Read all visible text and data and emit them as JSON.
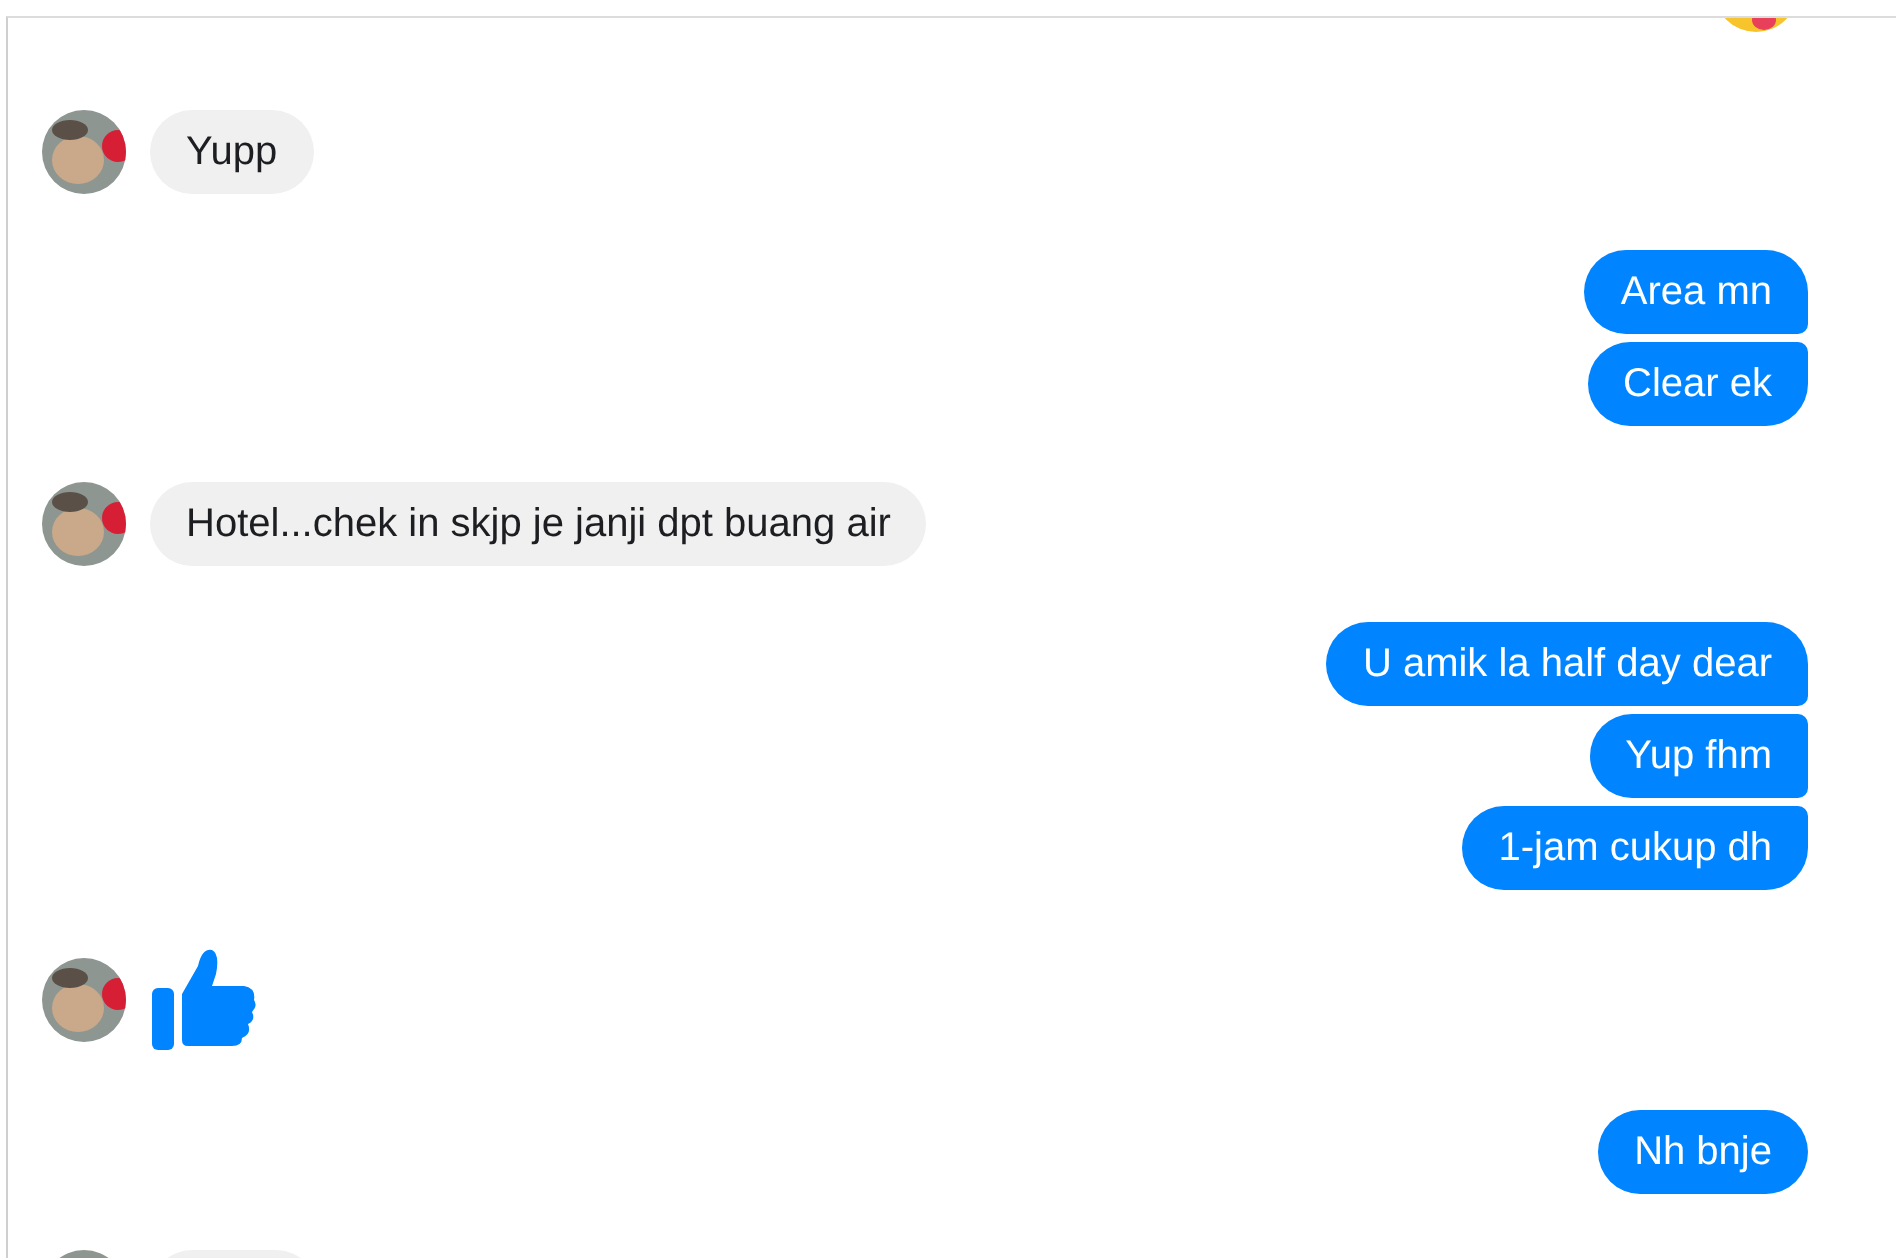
{
  "chat": {
    "groups": [
      {
        "kind": "outgoing",
        "messages": [
          {
            "kind": "emoji"
          }
        ]
      },
      {
        "kind": "incoming",
        "messages": [
          {
            "kind": "text",
            "text": "Yupp"
          }
        ]
      },
      {
        "kind": "outgoing",
        "messages": [
          {
            "kind": "text",
            "text": "Area mn"
          },
          {
            "kind": "text",
            "text": "Clear ek"
          }
        ]
      },
      {
        "kind": "incoming",
        "messages": [
          {
            "kind": "text",
            "text": "Hotel...chek in skjp je janji dpt buang air"
          }
        ]
      },
      {
        "kind": "outgoing",
        "messages": [
          {
            "kind": "text",
            "text": "U amik la half day dear"
          },
          {
            "kind": "text",
            "text": "Yup fhm"
          },
          {
            "kind": "text",
            "text": "1-jam cukup dh"
          }
        ]
      },
      {
        "kind": "incoming",
        "messages": [
          {
            "kind": "like"
          }
        ]
      },
      {
        "kind": "outgoing",
        "messages": [
          {
            "kind": "text",
            "text": "Nh bnje"
          }
        ]
      },
      {
        "kind": "incoming",
        "messages": [
          {
            "kind": "clipped"
          }
        ]
      }
    ]
  }
}
